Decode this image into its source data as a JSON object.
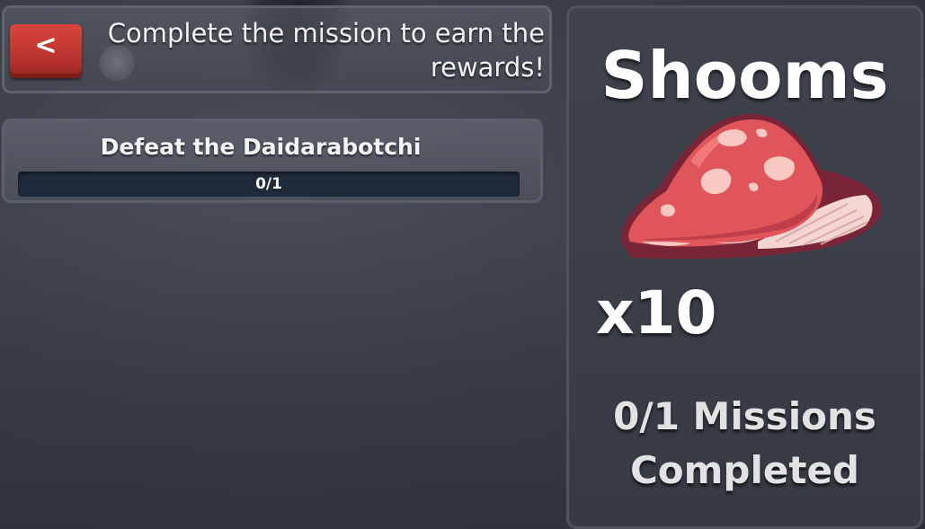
{
  "header": {
    "back_label": "<",
    "instruction": "Complete the mission to earn the rewards!"
  },
  "missions": [
    {
      "title": "Defeat the Daidarabotchi",
      "progress_text": "0/1",
      "progress": 0
    }
  ],
  "reward": {
    "name": "Shooms",
    "icon": "mushroom-icon",
    "quantity": "x10",
    "status": "0/1 Missions Completed"
  },
  "colors": {
    "back_button": "#c93a33",
    "progress_track": "#1f2b3a",
    "mushroom_cap": "#e0555a",
    "panel_border": "#5d636f"
  }
}
